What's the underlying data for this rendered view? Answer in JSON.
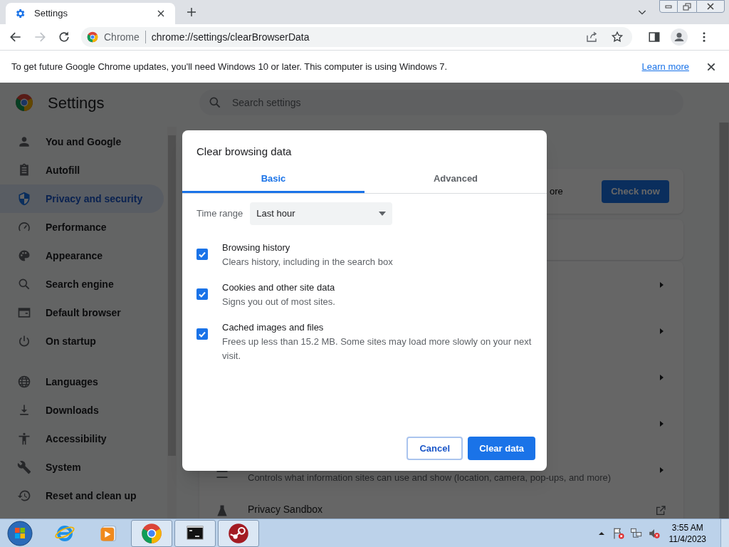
{
  "browser": {
    "tabs": [
      {
        "title": "Settings",
        "selected": true
      }
    ],
    "address_bar": {
      "site_label": "Chrome",
      "url": "chrome://settings/clearBrowserData"
    },
    "infobar": {
      "message": "To get future Google Chrome updates, you'll need Windows 10 or later. This computer is using Windows 7.",
      "link": "Learn more"
    }
  },
  "settings": {
    "title": "Settings",
    "search_placeholder": "Search settings",
    "nav": [
      {
        "label": "You and Google",
        "selected": false
      },
      {
        "label": "Autofill",
        "selected": false
      },
      {
        "label": "Privacy and security",
        "selected": true
      },
      {
        "label": "Performance",
        "selected": false
      },
      {
        "label": "Appearance",
        "selected": false
      },
      {
        "label": "Search engine",
        "selected": false
      },
      {
        "label": "Default browser",
        "selected": false
      },
      {
        "label": "On startup",
        "selected": false
      },
      {
        "label": "Languages",
        "selected": false
      },
      {
        "label": "Downloads",
        "selected": false
      },
      {
        "label": "Accessibility",
        "selected": false
      },
      {
        "label": "System",
        "selected": false
      },
      {
        "label": "Reset and clean up",
        "selected": false
      }
    ],
    "safety_check": {
      "text_fragment": "ore",
      "button": "Check now"
    },
    "site_settings_row": {
      "description": "Controls what information sites can use and show (location, camera, pop-ups, and more)"
    },
    "privacy_sandbox_row": {
      "label": "Privacy Sandbox"
    }
  },
  "dialog": {
    "title": "Clear browsing data",
    "tabs": [
      {
        "label": "Basic",
        "selected": true
      },
      {
        "label": "Advanced",
        "selected": false
      }
    ],
    "time_range": {
      "label": "Time range",
      "value": "Last hour"
    },
    "options": [
      {
        "title": "Browsing history",
        "description": "Clears history, including in the search box",
        "checked": true
      },
      {
        "title": "Cookies and other site data",
        "description": "Signs you out of most sites.",
        "checked": true
      },
      {
        "title": "Cached images and files",
        "description": "Frees up less than 15.2 MB. Some sites may load more slowly on your next visit.",
        "checked": true
      }
    ],
    "buttons": [
      {
        "label": "Cancel",
        "kind": "secondary"
      },
      {
        "label": "Clear data",
        "kind": "primary"
      }
    ]
  },
  "taskbar": {
    "apps": [
      {
        "kind": "ie",
        "running": false
      },
      {
        "kind": "media",
        "running": false
      },
      {
        "kind": "chrome",
        "running": true
      },
      {
        "kind": "terminal",
        "running": true
      },
      {
        "kind": "steam",
        "running": true
      }
    ],
    "clock": {
      "time": "3:55 AM",
      "date": "11/4/2023"
    }
  }
}
